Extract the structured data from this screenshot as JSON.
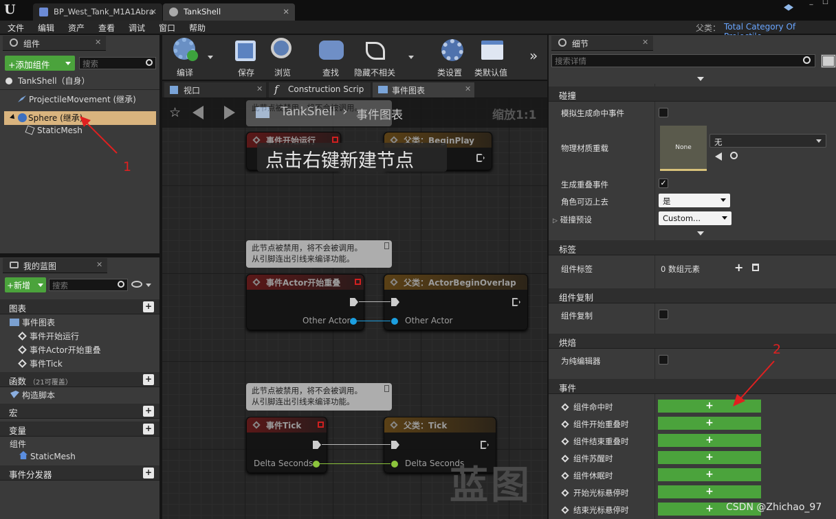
{
  "titlebar": {
    "logo": "U",
    "tabs": [
      {
        "label": "BP_West_Tank_M1A1Abra",
        "close": "✕"
      },
      {
        "label": "TankShell",
        "close": "✕"
      }
    ],
    "window_controls": [
      "_",
      "☐"
    ]
  },
  "menubar": {
    "items": [
      "文件",
      "编辑",
      "资产",
      "查看",
      "调试",
      "窗口",
      "帮助"
    ],
    "parent_class_label": "父类：",
    "parent_class_value": "Total Category Of Projectile"
  },
  "components_panel": {
    "title": "组件",
    "add_button": "+添加组件",
    "search_placeholder": "搜索",
    "items": [
      {
        "label": "TankShell（自身）"
      },
      {
        "label": "ProjectileMovement (继承)"
      },
      {
        "label": "Sphere (继承)",
        "selected": true
      },
      {
        "label": "StaticMesh"
      }
    ],
    "annotation": "1"
  },
  "my_blueprint": {
    "title": "我的蓝图",
    "new_button": "+新增",
    "search_placeholder": "搜索",
    "sections": {
      "graphs": "图表",
      "event_graph": "事件图表",
      "events": [
        "事件开始运行",
        "事件Actor开始重叠",
        "事件Tick"
      ],
      "functions": "函数",
      "functions_note": "（21可覆盖）",
      "construction": "构造脚本",
      "macros": "宏",
      "variables": "变量",
      "components": "组件",
      "static_mesh": "StaticMesh",
      "dispatchers": "事件分发器"
    }
  },
  "toolbar": {
    "buttons": [
      "编译",
      "保存",
      "浏览",
      "查找",
      "隐藏不相关",
      "类设置",
      "类默认值"
    ],
    "more": "»"
  },
  "editor_tabs": [
    "视口",
    "Construction Scrip",
    "事件图表"
  ],
  "graph": {
    "breadcrumb_root": "TankShell",
    "breadcrumb_sep": "›",
    "breadcrumb_current": "事件图表",
    "zoom": "缩放1:1",
    "hint": "点击右键新建节点",
    "watermark": "蓝图",
    "disabled_comment_line1": "此节点被禁用，将不会被调用。",
    "disabled_comment_line2": "从引脚连出引线来编译功能。",
    "nodes": {
      "begin_play": "事件开始运行",
      "parent_begin_play": "父类：BeginPlay",
      "overlap": "事件Actor开始重叠",
      "parent_overlap": "父类：ActorBeginOverlap",
      "other_actor": "Other Actor",
      "tick": "事件Tick",
      "parent_tick": "父类：Tick",
      "delta_seconds": "Delta Seconds"
    },
    "comment_top_line1": "此节点被禁用，将不会被调用。"
  },
  "details": {
    "title": "细节",
    "search_placeholder": "搜索详情",
    "collision": {
      "header": "碰撞",
      "sim_hit": "模拟生成命中事件",
      "phys_mat": "物理材质重载",
      "phys_mat_thumb": "None",
      "phys_mat_value": "无",
      "gen_overlap": "生成重叠事件",
      "can_step": "角色可迈上去",
      "can_step_value": "是",
      "preset": "碰撞预设",
      "preset_value": "Custom..."
    },
    "tags": {
      "header": "标签",
      "comp_tags": "组件标签",
      "count": "0 数组元素"
    },
    "replication": {
      "header": "组件复制",
      "item": "组件复制"
    },
    "cooking": {
      "header": "烘焙",
      "item": "为纯编辑器"
    },
    "events": {
      "header": "事件",
      "items": [
        "组件命中时",
        "组件开始重叠时",
        "组件结束重叠时",
        "组件苏醒时",
        "组件休眠时",
        "开始光标悬停时",
        "结束光标悬停时"
      ],
      "add": "+"
    },
    "annotation": "2"
  },
  "watermark_csdn": "CSDN @Zhichao_97",
  "colors": {
    "accent_green": "#4ba33c",
    "selected_row": "#d9b47e",
    "annotation_red": "#e02020"
  }
}
